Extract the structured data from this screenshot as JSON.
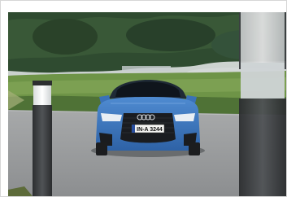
{
  "photo": {
    "scene": "photograph",
    "license_plate": "IN-A 3244",
    "palette": {
      "sky": "#e4e8ea",
      "forest": "#2c4a2e",
      "meadow": "#6f9a4a",
      "road": "#9a9c9e",
      "car_body": "#3d7bc4",
      "bollard": "#3a3c3e"
    }
  }
}
